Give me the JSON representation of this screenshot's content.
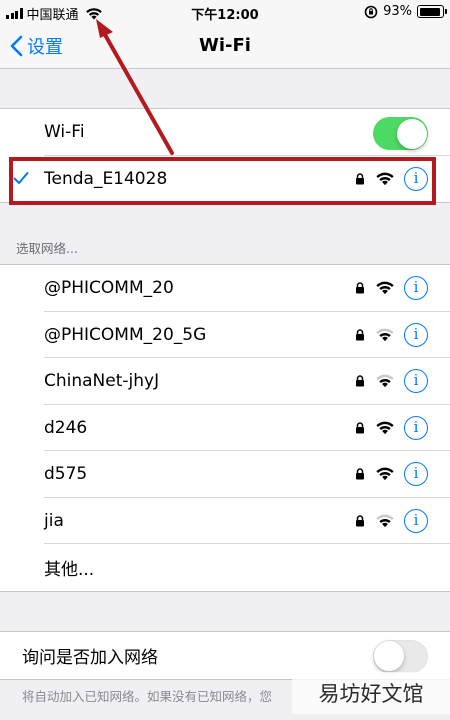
{
  "status_bar": {
    "carrier": "中国联通",
    "time": "下午12:00",
    "battery": "93%",
    "battery_level": 0.93
  },
  "nav": {
    "back_label": "设置",
    "title": "Wi-Fi"
  },
  "wifi_toggle": {
    "label": "Wi-Fi",
    "on": true
  },
  "connected": {
    "name": "Tenda_E14028",
    "locked": true,
    "strength": "full"
  },
  "section_label": "选取网络...",
  "networks": [
    {
      "name": "@PHICOMM_20",
      "locked": true,
      "strength": "full"
    },
    {
      "name": "@PHICOMM_20_5G",
      "locked": true,
      "strength": "weak"
    },
    {
      "name": "ChinaNet-jhyJ",
      "locked": true,
      "strength": "weak"
    },
    {
      "name": "d246",
      "locked": true,
      "strength": "full"
    },
    {
      "name": "d575",
      "locked": true,
      "strength": "full"
    },
    {
      "name": "jia",
      "locked": true,
      "strength": "weak"
    }
  ],
  "other_label": "其他...",
  "ask_join": {
    "label": "询问是否加入网络",
    "on": false
  },
  "footer_note": "将自动加入已知网络。如果没有已知网络，您",
  "info_glyph": "i",
  "watermark": "易坊好文馆",
  "colors": {
    "accent": "#007aff",
    "toggle_on": "#4cd964",
    "annotation": "#b3191d"
  },
  "icons": [
    "signal-bars-icon",
    "wifi-icon",
    "chevron-left-icon",
    "checkmark-icon",
    "lock-icon",
    "info-icon",
    "alarm-lock-icon",
    "battery-icon"
  ]
}
